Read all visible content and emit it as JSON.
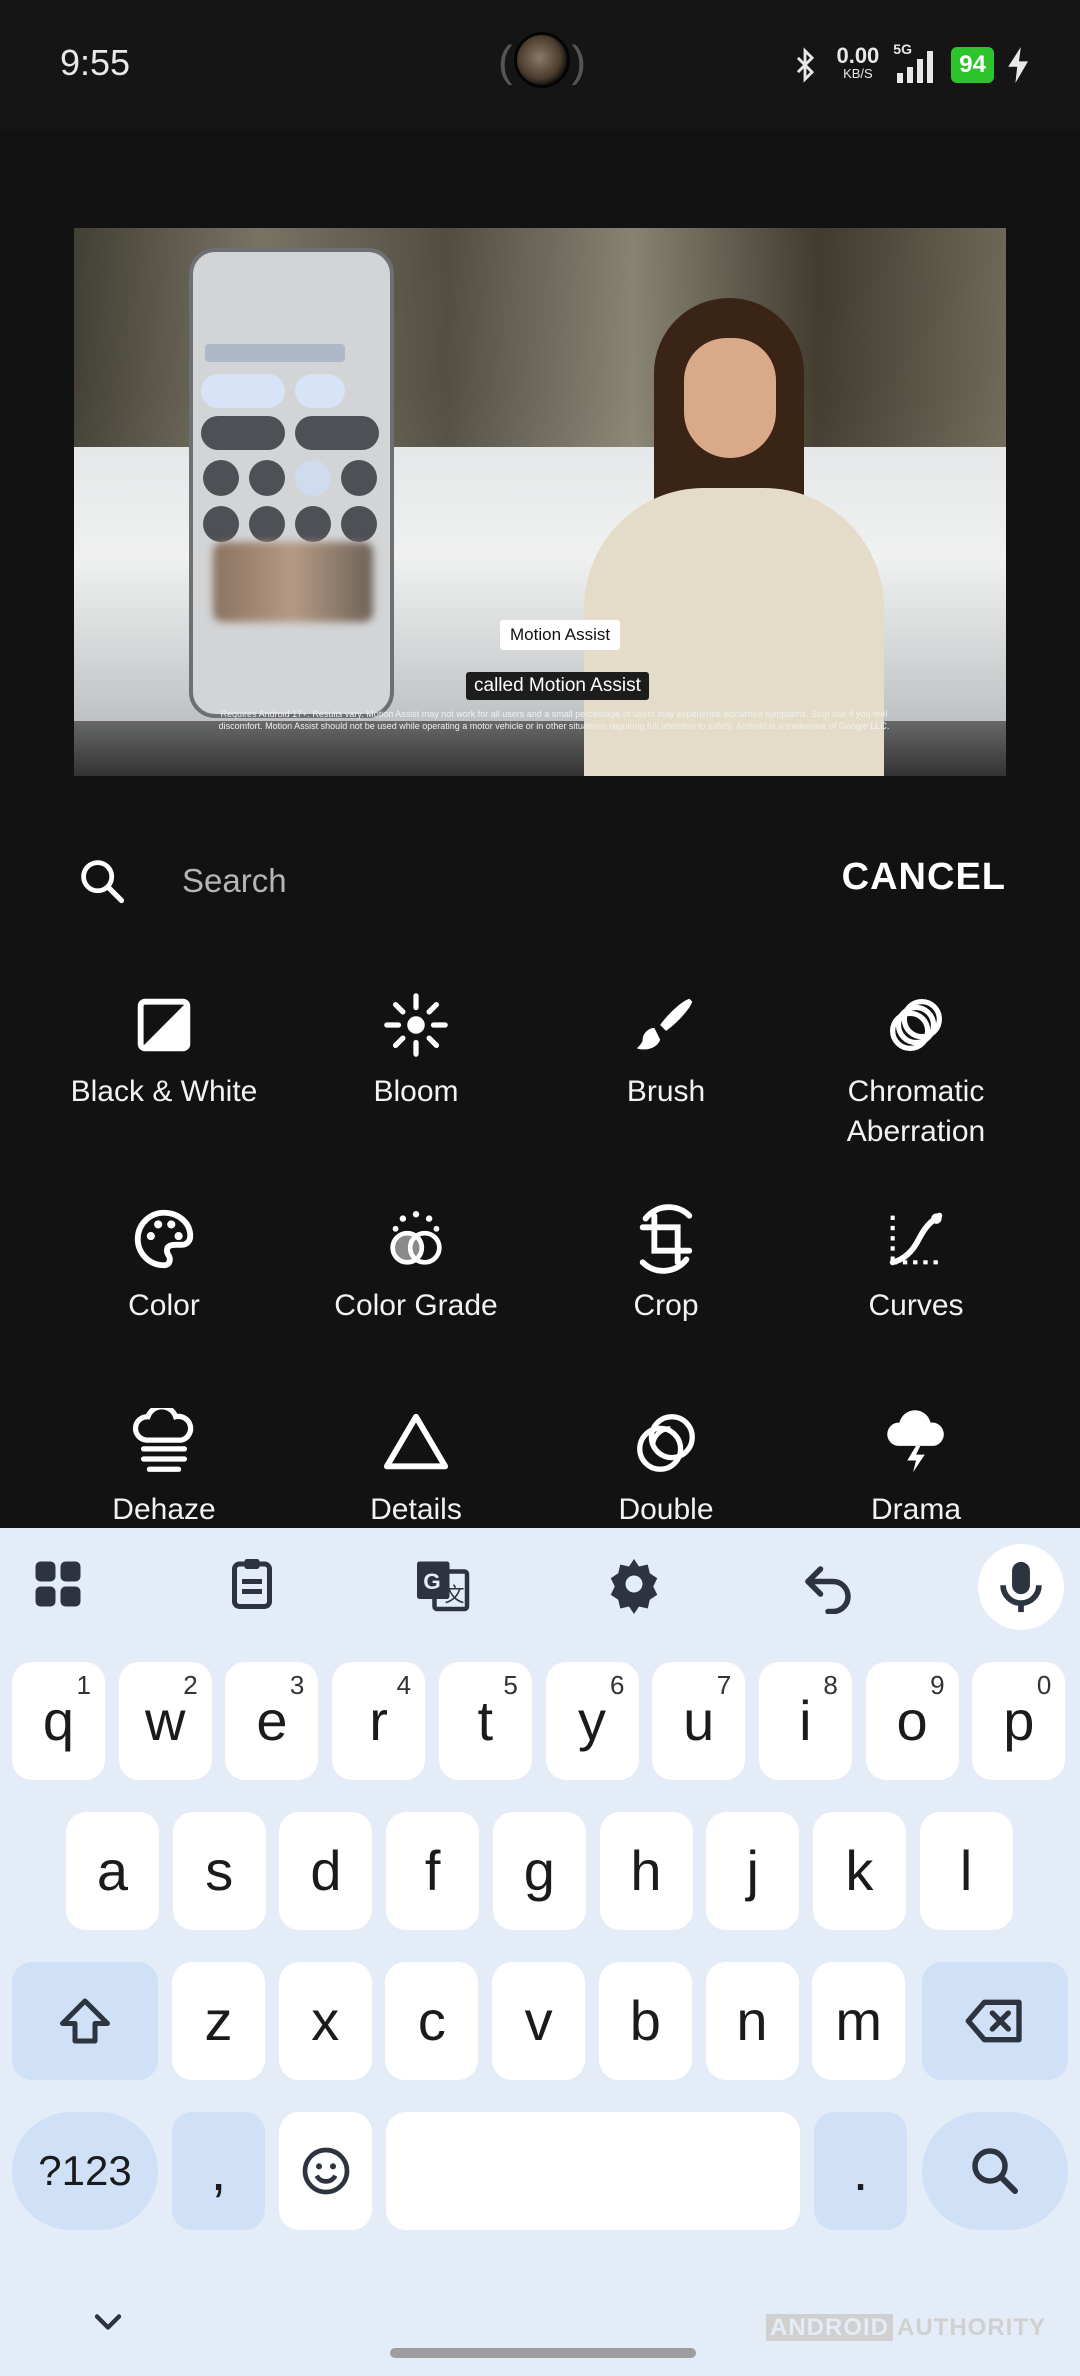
{
  "status_bar": {
    "time": "9:55",
    "net_speed": "0.00",
    "net_speed_unit": "KB/S",
    "network_label": "5G",
    "battery": "94",
    "icons": [
      "bluetooth-icon",
      "signal-icon",
      "charging-icon"
    ]
  },
  "preview": {
    "caption_label": "Motion Assist",
    "caption_subtitle": "called Motion Assist",
    "fine_print": "Requires Android 17+. Results vary. Motion Assist may not work for all users and a small percentage of users may experience worsened symptoms. Stop use if you feel discomfort. Motion Assist should not be used while operating a motor vehicle or in other situations requiring full attention to safety. Android is a trademark of Google LLC."
  },
  "search": {
    "placeholder": "Search",
    "cancel_label": "CANCEL"
  },
  "filters": [
    {
      "label": "Black & White",
      "icon": "black-white-icon"
    },
    {
      "label": "Bloom",
      "icon": "bloom-icon"
    },
    {
      "label": "Brush",
      "icon": "brush-icon"
    },
    {
      "label": "Chromatic\nAberration",
      "icon": "chromatic-aberration-icon"
    },
    {
      "label": "Color",
      "icon": "palette-icon"
    },
    {
      "label": "Color Grade",
      "icon": "color-grade-icon"
    },
    {
      "label": "Crop",
      "icon": "crop-icon"
    },
    {
      "label": "Curves",
      "icon": "curves-icon"
    },
    {
      "label": "Dehaze",
      "icon": "dehaze-icon"
    },
    {
      "label": "Details",
      "icon": "details-icon"
    },
    {
      "label": "Double",
      "icon": "double-exposure-icon"
    },
    {
      "label": "Drama",
      "icon": "drama-icon"
    }
  ],
  "keyboard": {
    "toolbar": [
      "apps-grid-icon",
      "clipboard-icon",
      "translate-icon",
      "settings-gear-icon",
      "undo-icon",
      "mic-icon"
    ],
    "row1": [
      {
        "k": "q",
        "n": "1"
      },
      {
        "k": "w",
        "n": "2"
      },
      {
        "k": "e",
        "n": "3"
      },
      {
        "k": "r",
        "n": "4"
      },
      {
        "k": "t",
        "n": "5"
      },
      {
        "k": "y",
        "n": "6"
      },
      {
        "k": "u",
        "n": "7"
      },
      {
        "k": "i",
        "n": "8"
      },
      {
        "k": "o",
        "n": "9"
      },
      {
        "k": "p",
        "n": "0"
      }
    ],
    "row2": [
      "a",
      "s",
      "d",
      "f",
      "g",
      "h",
      "j",
      "k",
      "l"
    ],
    "row3": [
      "z",
      "x",
      "c",
      "v",
      "b",
      "n",
      "m"
    ],
    "symbols_label": "?123",
    "comma": ",",
    "period": "."
  },
  "watermark": {
    "brand": "ANDROID",
    "suffix": "AUTHORITY"
  },
  "colors": {
    "background": "#121212",
    "keyboard_bg": "#e3ecf7",
    "modifier_key": "#cfe0f7",
    "battery": "#2ec42e"
  }
}
